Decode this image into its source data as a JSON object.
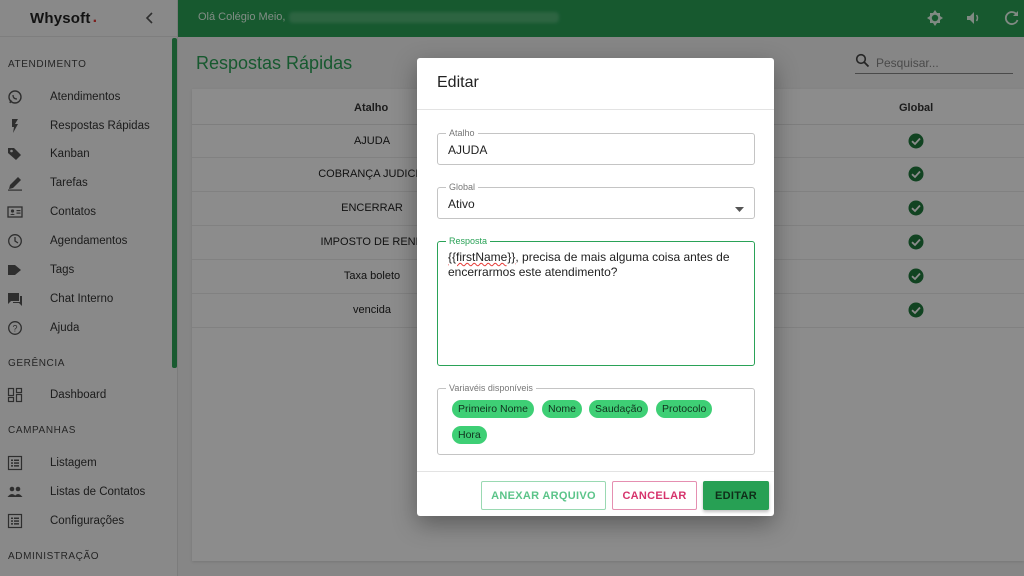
{
  "app": {
    "logo": "Whysoft",
    "logo_dot": "."
  },
  "topbar": {
    "greeting": "Olá Colégio Meio,"
  },
  "sidebar": {
    "sections": [
      {
        "label": "ATENDIMENTO"
      },
      {
        "label": "GERÊNCIA"
      },
      {
        "label": "CAMPANHAS"
      },
      {
        "label": "ADMINISTRAÇÃO"
      }
    ],
    "items": [
      {
        "label": "Atendimentos",
        "icon": "whatsapp-icon"
      },
      {
        "label": "Respostas Rápidas",
        "icon": "bolt-icon"
      },
      {
        "label": "Kanban",
        "icon": "tags-icon"
      },
      {
        "label": "Tarefas",
        "icon": "pencil-icon"
      },
      {
        "label": "Contatos",
        "icon": "contact-card-icon"
      },
      {
        "label": "Agendamentos",
        "icon": "clock-icon"
      },
      {
        "label": "Tags",
        "icon": "tag-icon"
      },
      {
        "label": "Chat Interno",
        "icon": "chat-icon"
      },
      {
        "label": "Ajuda",
        "icon": "help-icon"
      },
      {
        "label": "Dashboard",
        "icon": "dashboard-icon"
      },
      {
        "label": "Listagem",
        "icon": "list-icon"
      },
      {
        "label": "Listas de Contatos",
        "icon": "people-icon"
      },
      {
        "label": "Configurações",
        "icon": "list-icon"
      }
    ]
  },
  "page": {
    "title": "Respostas Rápidas",
    "search_placeholder": "Pesquisar...",
    "table": {
      "headers": {
        "atalho": "Atalho",
        "global": "Global"
      },
      "rows": [
        {
          "atalho": "AJUDA",
          "global": true
        },
        {
          "atalho": "COBRANÇA JUDICIA",
          "global": true
        },
        {
          "atalho": "ENCERRAR",
          "global": true
        },
        {
          "atalho": "IMPOSTO DE REND",
          "global": true
        },
        {
          "atalho": "Taxa boleto",
          "global": true
        },
        {
          "atalho": "vencida",
          "global": true
        }
      ]
    }
  },
  "modal": {
    "title": "Editar",
    "atalho": {
      "label": "Atalho",
      "value": "AJUDA"
    },
    "global": {
      "label": "Global",
      "value": "Ativo"
    },
    "resposta": {
      "label": "Resposta",
      "variable": "{{firstName}}",
      "text_rest": ", precisa de mais alguma coisa antes de encerrarmos este atendimento?"
    },
    "variables": {
      "label": "Variavéis disponíveis",
      "chips": [
        "Primeiro Nome",
        "Nome",
        "Saudação",
        "Protocolo",
        "Hora"
      ]
    },
    "buttons": {
      "anexar": "ANEXAR ARQUIVO",
      "cancelar": "CANCELAR",
      "editar": "EDITAR"
    }
  },
  "colors": {
    "brand_green": "#2aa257",
    "chip_green": "#3ecf75",
    "cancel_pink": "#d6336c"
  }
}
